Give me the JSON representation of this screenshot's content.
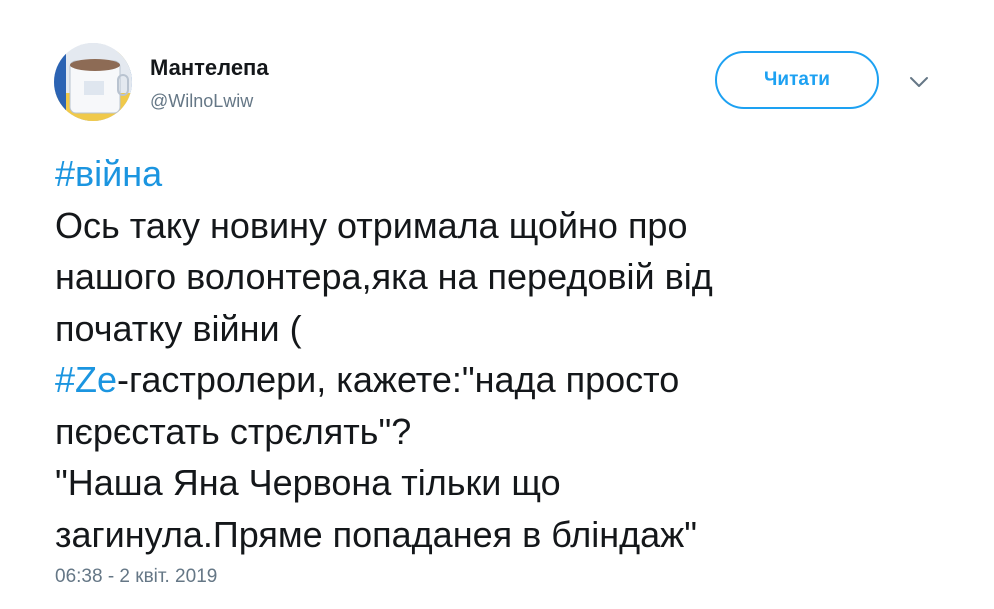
{
  "author": {
    "name": "Мантелепа",
    "handle": "@WilnoLwiw"
  },
  "follow_button": {
    "label": "Читати"
  },
  "tweet": {
    "hashtag_1": "#війна",
    "line_2": "Ось таку новину отримала щойно про",
    "line_3": "нашого волонтера,яка на передовій від",
    "line_4": "початку війни (",
    "hashtag_2": "#Ze",
    "line_5_rest": "-гастролери, кажете:\"нада просто",
    "line_6": "пєрєстать стрєлять\"?",
    "line_7": "\"Наша Яна Червона тільки що",
    "line_8": "загинула.Пряме попаданея в бліндаж\""
  },
  "timestamp": "06:38 - 2 квіт. 2019",
  "icons": {
    "menu": "chevron-down-icon"
  },
  "colors": {
    "accent": "#1da1f2",
    "hashtag": "#1b95e0",
    "secondary_text": "#657786",
    "text": "#14171a"
  }
}
